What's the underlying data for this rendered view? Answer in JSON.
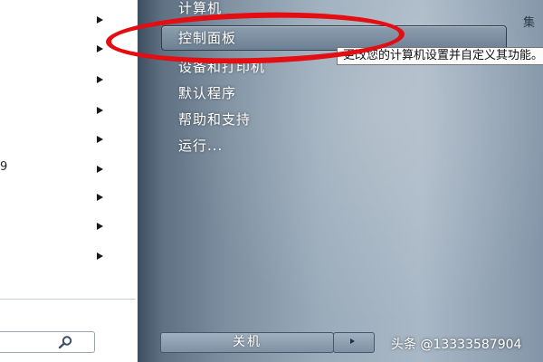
{
  "left_panel": {
    "fragment_text": "9",
    "submenu_arrow_count": 9
  },
  "right_panel": {
    "items": [
      {
        "label": "计算机"
      },
      {
        "label": "控制面板"
      },
      {
        "label": "设备和打印机"
      },
      {
        "label": "默认程序"
      },
      {
        "label": "帮助和支持"
      },
      {
        "label": "运行..."
      }
    ],
    "top_fragment": "集",
    "tooltip": "更改您的计算机设置并自定义其功能。"
  },
  "shutdown": {
    "label": "关机"
  },
  "watermark": {
    "text": "头条 @13333587904"
  },
  "colors": {
    "annotation_red": "#e30d12"
  }
}
